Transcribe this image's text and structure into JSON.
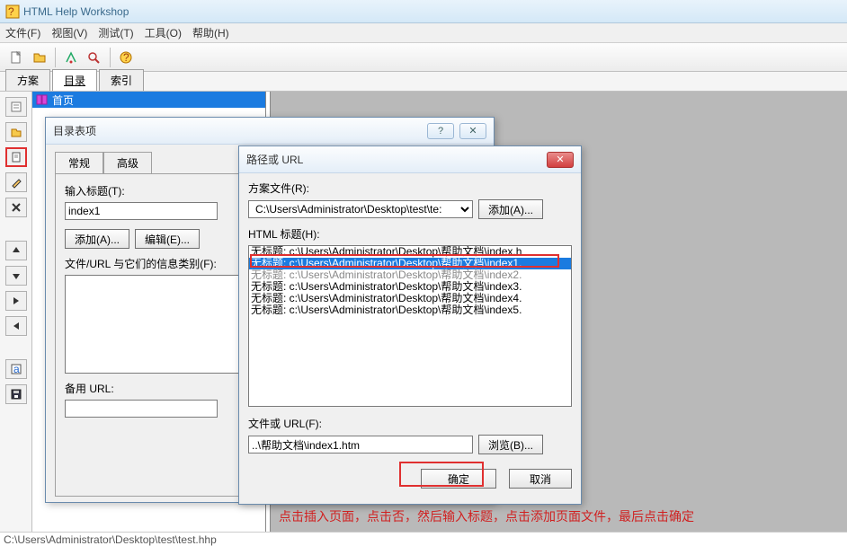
{
  "titlebar": {
    "title": "HTML Help Workshop"
  },
  "menubar": {
    "file": "文件(F)",
    "view": "视图(V)",
    "test": "测试(T)",
    "tools": "工具(O)",
    "help": "帮助(H)"
  },
  "main_tabs": {
    "plan": "方案",
    "contents": "目录",
    "index": "索引"
  },
  "tree": {
    "root": "首页"
  },
  "dialog1": {
    "title": "目录表项",
    "tabs": {
      "general": "常规",
      "advanced": "高级"
    },
    "input_label": "输入标题(T):",
    "input_value": "index1",
    "add_btn": "添加(A)...",
    "edit_btn": "编辑(E)...",
    "assoc_label": "文件/URL 与它们的信息类别(F):",
    "alt_url_label": "备用 URL:"
  },
  "dialog2": {
    "title": "路径或 URL",
    "project_label": "方案文件(R):",
    "project_value": "C:\\Users\\Administrator\\Desktop\\test\\te:",
    "add_btn": "添加(A)...",
    "html_title_label": "HTML 标题(H):",
    "list": [
      "无标题:  c:\\Users\\Administrator\\Desktop\\帮助文档\\index.h",
      "无标题:  c:\\Users\\Administrator\\Desktop\\帮助文档\\index1.",
      "无标题:  c:\\Users\\Administrator\\Desktop\\帮助文档\\index2.",
      "无标题:  c:\\Users\\Administrator\\Desktop\\帮助文档\\index3.",
      "无标题:  c:\\Users\\Administrator\\Desktop\\帮助文档\\index4.",
      "无标题:  c:\\Users\\Administrator\\Desktop\\帮助文档\\index5."
    ],
    "file_url_label": "文件或 URL(F):",
    "file_url_value": "..\\帮助文档\\index1.htm",
    "browse_btn": "浏览(B)...",
    "ok_btn": "确定",
    "cancel_btn": "取消"
  },
  "annotation": "点击插入页面，点击否，然后输入标题，点击添加页面文件，最后点击确定",
  "statusbar": "C:\\Users\\Administrator\\Desktop\\test\\test.hhp"
}
